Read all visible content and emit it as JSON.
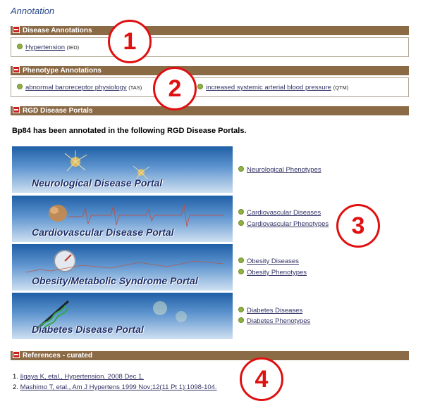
{
  "page_title": "Annotation",
  "sections": {
    "disease": {
      "title": "Disease Annotations",
      "items": [
        {
          "term": "Hypertension",
          "code": "(IED)"
        }
      ]
    },
    "phenotype": {
      "title": "Phenotype Annotations",
      "items": [
        {
          "term": "abnormal baroreceptor physiology",
          "code": "(TAS)"
        },
        {
          "term": "increased systemic arterial blood pressure",
          "code": "(QTM)"
        }
      ]
    },
    "portals": {
      "title": "RGD Disease Portals",
      "intro": "Bp84 has been annotated in the following RGD Disease Portals.",
      "items": [
        {
          "banner": "Neurological Disease Portal",
          "links": [
            "Neurological Phenotypes"
          ]
        },
        {
          "banner": "Cardiovascular Disease Portal",
          "links": [
            "Cardiovascular Diseases",
            "Cardiovascular Phenotypes"
          ]
        },
        {
          "banner": "Obesity/Metabolic Syndrome Portal",
          "links": [
            "Obesity Diseases",
            "Obesity Phenotypes"
          ]
        },
        {
          "banner": "Diabetes Disease Portal",
          "links": [
            "Diabetes Diseases",
            "Diabetes Phenotypes"
          ]
        }
      ]
    },
    "references": {
      "title": "References - curated",
      "items": [
        {
          "num": "1.",
          "text": "Iigaya K, etal., Hypertension. 2008 Dec 1."
        },
        {
          "num": "2.",
          "text": "Mashimo T, etal., Am J Hypertens 1999 Nov;12(11 Pt 1):1098-104."
        }
      ]
    }
  },
  "callouts": [
    "1",
    "2",
    "3",
    "4"
  ],
  "colors": {
    "section_bar": "#8b6a46",
    "callout": "#e01010",
    "bullet": "#8fb043",
    "toggle": "#cc1f1f"
  }
}
